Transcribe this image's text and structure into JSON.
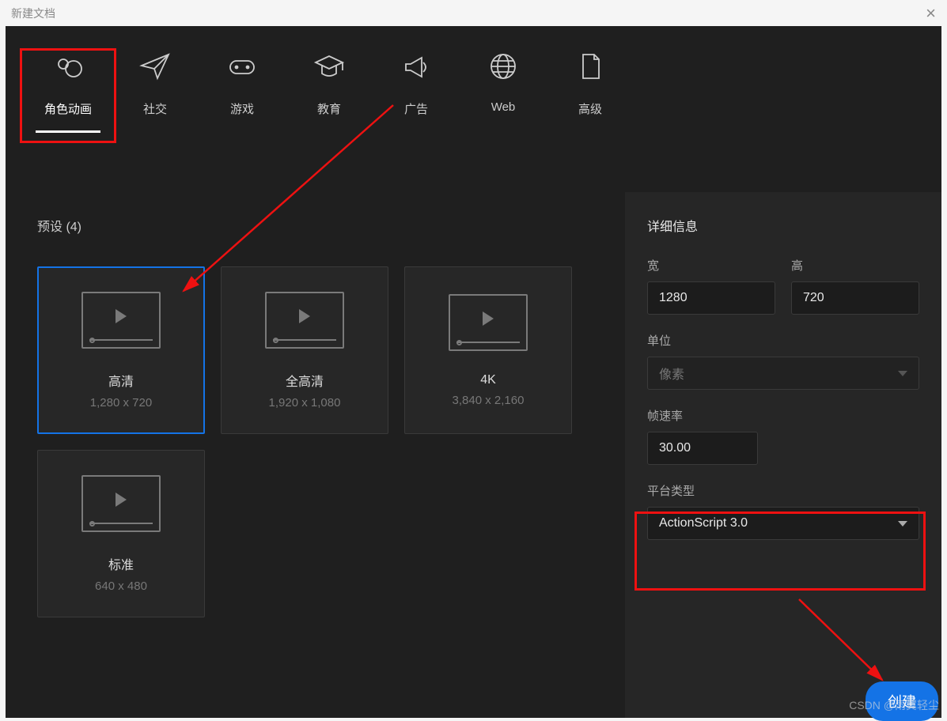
{
  "window": {
    "title": "新建文档"
  },
  "tabs": [
    {
      "id": "character",
      "label": "角色动画"
    },
    {
      "id": "social",
      "label": "社交"
    },
    {
      "id": "game",
      "label": "游戏"
    },
    {
      "id": "education",
      "label": "教育"
    },
    {
      "id": "ads",
      "label": "广告"
    },
    {
      "id": "web",
      "label": "Web"
    },
    {
      "id": "advanced",
      "label": "高级"
    }
  ],
  "active_tab": 0,
  "presets": {
    "label": "预设 (4)",
    "items": [
      {
        "name": "高清",
        "dim": "1,280 x 720",
        "selected": true
      },
      {
        "name": "全高清",
        "dim": "1,920 x 1,080",
        "selected": false
      },
      {
        "name": "4K",
        "dim": "3,840 x 2,160",
        "selected": false
      },
      {
        "name": "标准",
        "dim": "640 x 480",
        "selected": false
      }
    ]
  },
  "details": {
    "title": "详细信息",
    "width_label": "宽",
    "width_value": "1280",
    "height_label": "高",
    "height_value": "720",
    "unit_label": "单位",
    "unit_value": "像素",
    "fps_label": "帧速率",
    "fps_value": "30.00",
    "platform_label": "平台类型",
    "platform_value": "ActionScript 3.0"
  },
  "create_label": "创建",
  "watermark": "CSDN @雨翼轻尘"
}
